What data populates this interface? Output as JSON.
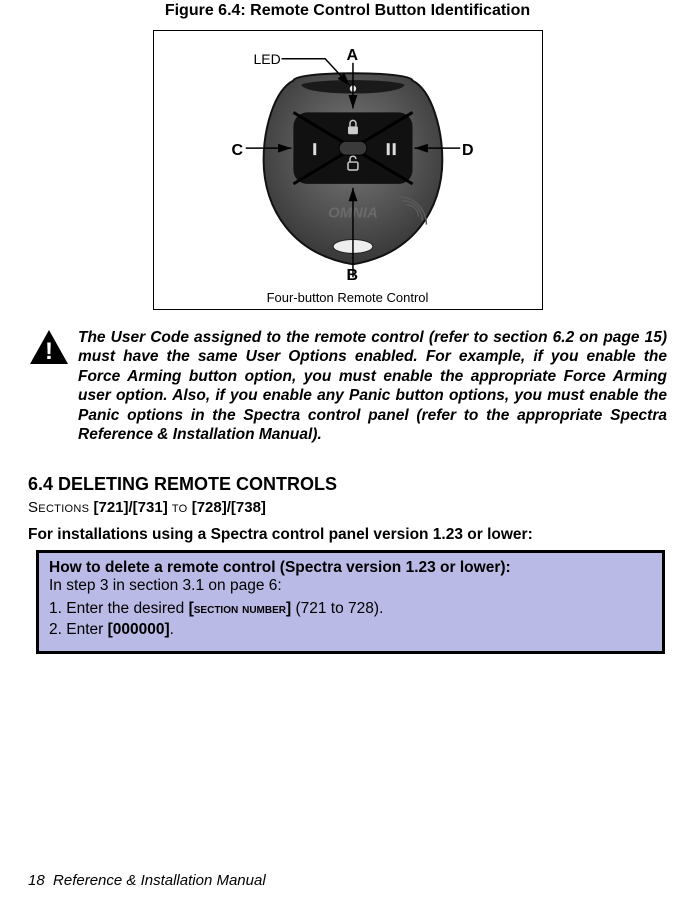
{
  "figure": {
    "title": "Figure 6.4: Remote Control Button Identification",
    "led_label": "LED",
    "label_A": "A",
    "label_B": "B",
    "label_C": "C",
    "label_D": "D",
    "brand": "OMNIA",
    "caption": "Four-button Remote Control"
  },
  "warning": {
    "text": "The User Code assigned to the remote control (refer to section 6.2 on page 15) must have the same User Options enabled. For example, if you enable the Force Arming button option, you must enable the appropriate Force Arming user option. Also, if you enable any Panic button options, you must enable the Panic options in the Spectra control panel (refer to the appropriate Spectra Reference & Installation Manual)."
  },
  "section": {
    "heading": "6.4 DELETING REMOTE CONTROLS",
    "sections_prefix": "Sections",
    "sections_range1": "[721]/[731]",
    "sections_mid": "to",
    "sections_range2": "[728]/[738]",
    "instruction": "For installations using a Spectra control panel version 1.23 or lower:"
  },
  "howto": {
    "title": "How to delete a remote control (Spectra version 1.23 or lower):",
    "sub": "In step 3 in section 3.1 on page 6:",
    "step1_pre": "1. Enter the desired ",
    "step1_code_open": "[",
    "step1_code": "section number",
    "step1_code_close": "]",
    "step1_post": " (721 to 728).",
    "step2": "2. Enter [000000]."
  },
  "footer": {
    "page": "18",
    "text": "Reference & Installation Manual"
  }
}
